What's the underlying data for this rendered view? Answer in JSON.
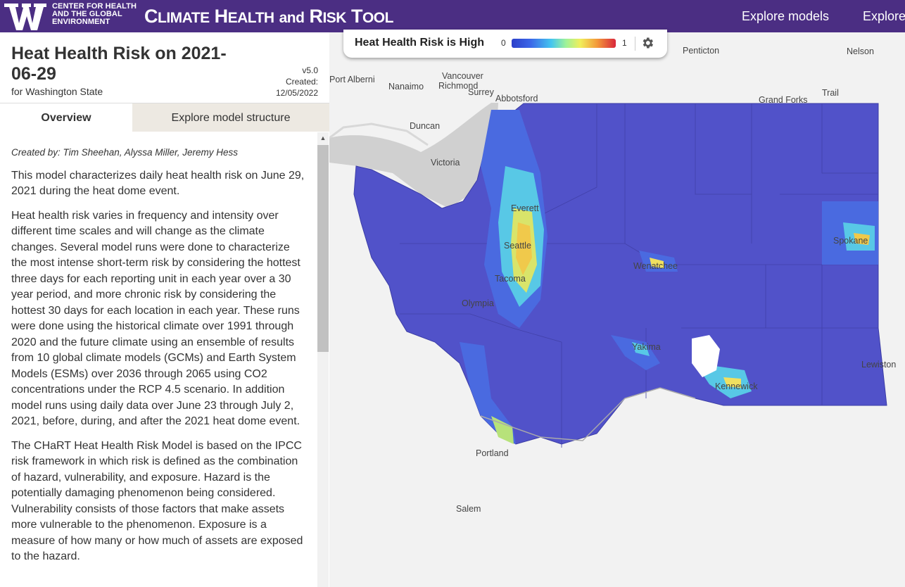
{
  "header": {
    "org_line1": "CENTER FOR HEALTH",
    "org_line2": "AND THE GLOBAL",
    "org_line3": "ENVIRONMENT",
    "title_c": "C",
    "title_limate": "LIMATE",
    "title_h": "H",
    "title_ealth": "EALTH",
    "title_and": "and",
    "title_r": "R",
    "title_isk": "ISK",
    "title_t": "T",
    "title_ool": "OOL",
    "nav": [
      "Explore models",
      "Explore"
    ],
    "brand_color": "#4b2e83"
  },
  "panel": {
    "title": "Heat Health Risk on 2021-06-29",
    "subtitle": "for Washington State",
    "version": "v5.0",
    "created_label": "Created:",
    "created_date": "12/05/2022",
    "tabs": [
      "Overview",
      "Explore model structure"
    ],
    "credit": "Created by: Tim Sheehan, Alyssa Miller, Jeremy Hess",
    "paragraphs": [
      "This model characterizes daily heat health risk on June 29, 2021 during the heat dome event.",
      "Heat health risk varies in frequency and intensity over different time scales and will change as the climate changes. Several model runs were done to characterize the most intense short-term risk by considering the hottest three days for each reporting unit in each year over a 30 year period, and more chronic risk by considering the hottest 30 days for each location in each year. These runs were done using the historical climate over 1991 through 2020 and the future climate using an ensemble of results from 10 global climate models (GCMs) and Earth System Models (ESMs) over 2036 through 2065 using CO2 concentrations under the RCP 4.5 scenario. In addition model runs using daily data over June 23 through July 2, 2021, before, during, and after the 2021 heat dome event.",
      "The CHaRT Heat Health Risk Model is based on the IPCC risk framework in which risk is defined as the combination of hazard, vulnerability, and exposure. Hazard is the potentially damaging phenomenon being considered. Vulnerability consists of those factors that make assets more vulnerable to the phenomenon. Exposure is a measure of how many or how much of assets are exposed to the hazard."
    ]
  },
  "legend": {
    "title": "Heat Health Risk is High",
    "min": "0",
    "max": "1",
    "settings_icon": "gear-icon"
  },
  "map": {
    "cities": [
      "Penticton",
      "Nelson",
      "Port Alberni",
      "Vancouver",
      "Nanaimo",
      "Richmond",
      "Surrey",
      "Abbotsford",
      "Trail",
      "Grand Forks",
      "Duncan",
      "Victoria",
      "Everett",
      "Seattle",
      "Tacoma",
      "Olympia",
      "Wenatchee",
      "Yakima",
      "Kennewick",
      "Spokane",
      "Lewiston",
      "Portland",
      "Salem"
    ],
    "colors": {
      "base": "#5152c9",
      "low": "#4a6ae0",
      "mid": "#58c8e6",
      "high": "#f0e060",
      "water": "#cfcfcf",
      "land": "#f2f2f2"
    }
  }
}
